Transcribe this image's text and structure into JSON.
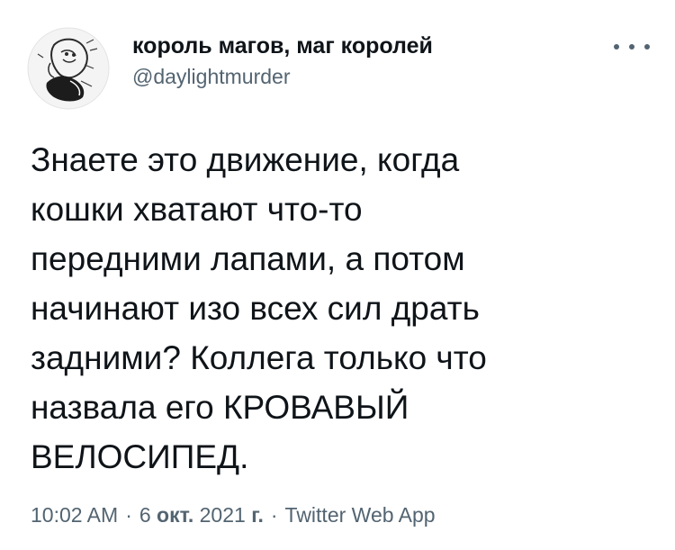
{
  "tweet": {
    "author": {
      "display_name": "король магов, маг королей",
      "handle": "@daylightmurder",
      "avatar_icon": "avatar-sketch-icon"
    },
    "more_icon": "more-options-icon",
    "text": "Знаете это движение, когда\nкошки хватают что-то\nпередними лапами, а потом\nначинают изо всех сил драть\nзадними? Коллега только что\nназвала его КРОВАВЫЙ\nВЕЛОСИПЕД.",
    "meta": {
      "time": "10:02 AM",
      "separator": "·",
      "day": "6",
      "month": "окт.",
      "year": "2021",
      "year_suffix": "г.",
      "app": "Twitter Web App"
    }
  },
  "colors": {
    "text_primary": "#0f1419",
    "text_secondary": "#536471",
    "background": "#ffffff"
  }
}
